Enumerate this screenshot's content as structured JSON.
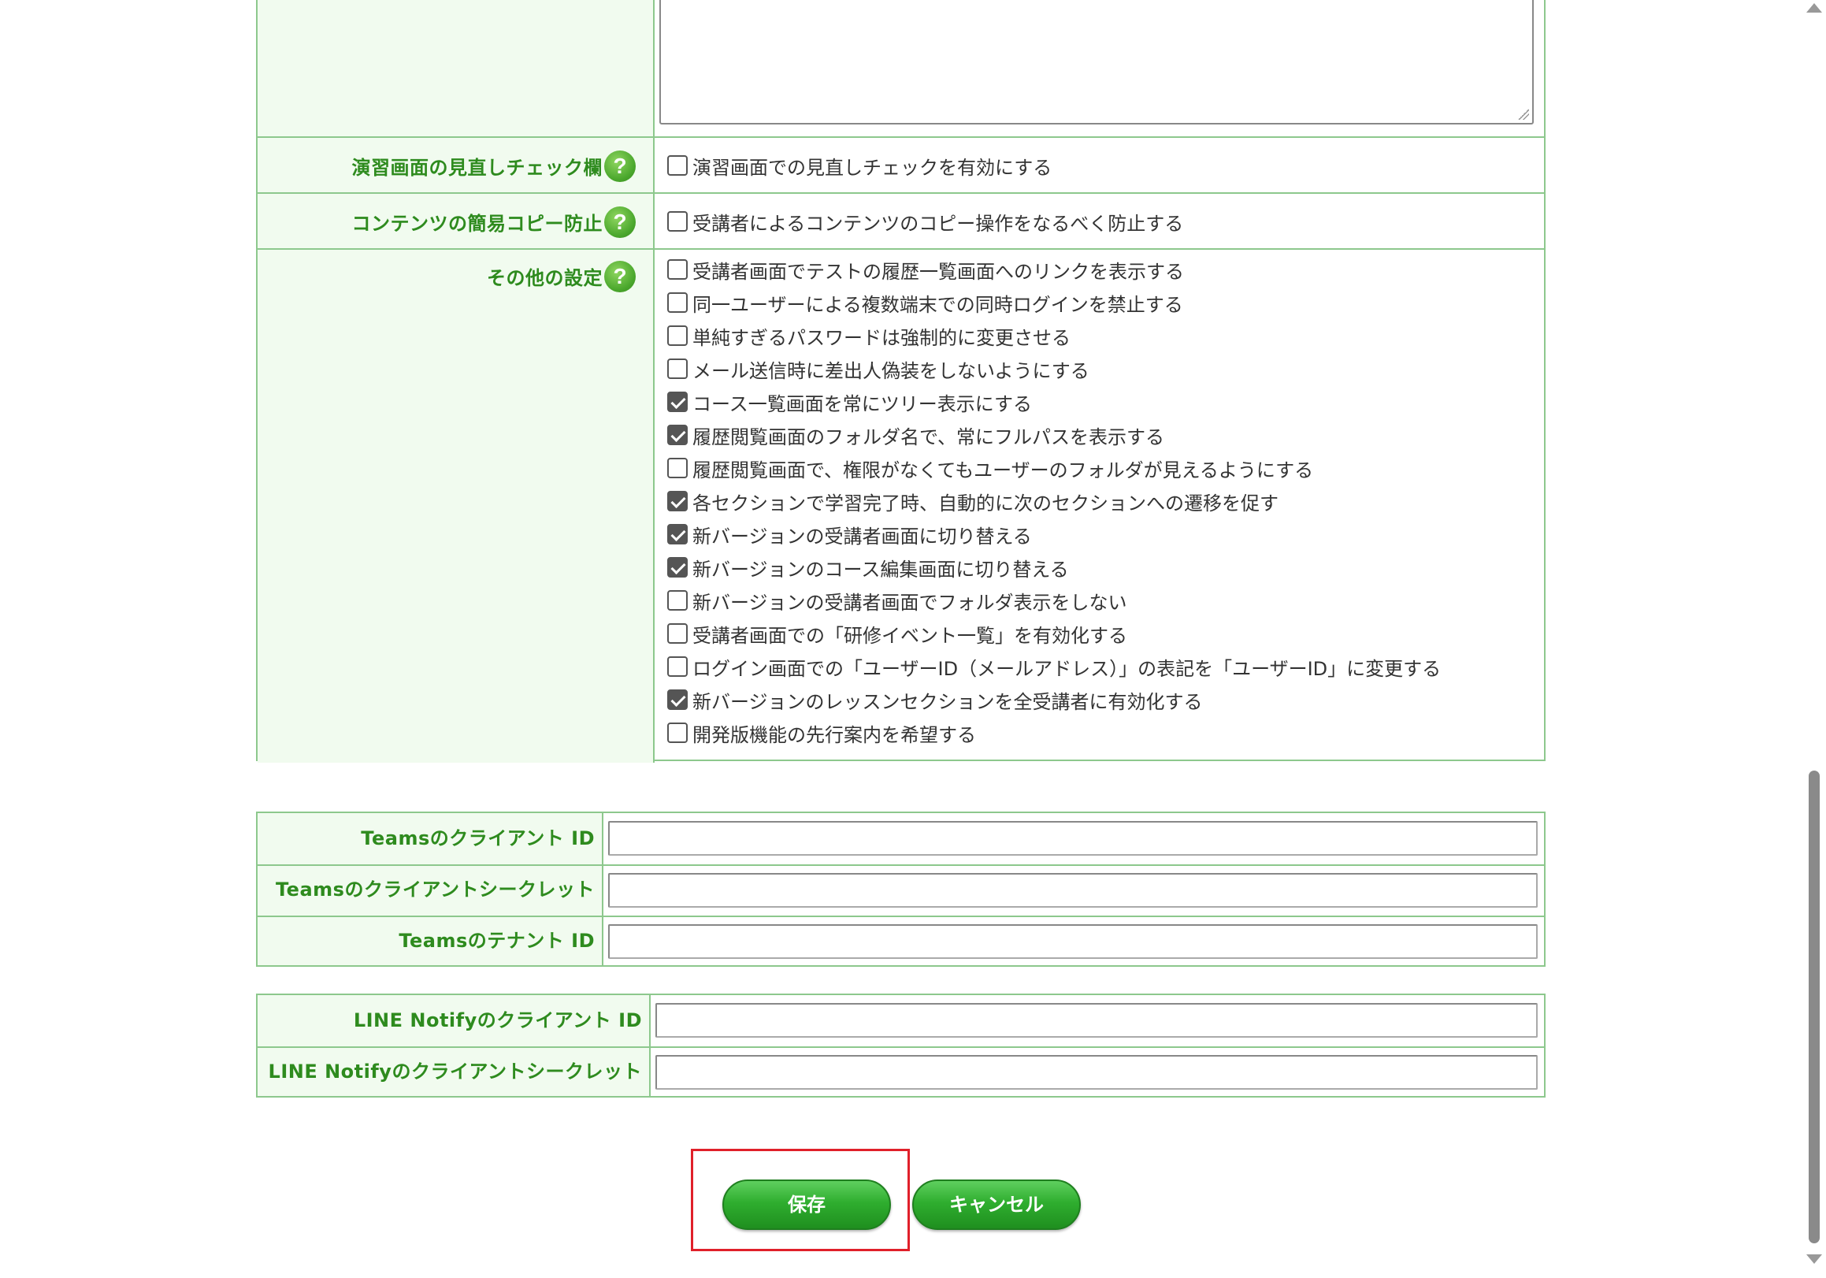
{
  "settings": {
    "exercise_review": {
      "label": "演習画面の見直しチェック欄",
      "option": "演習画面での見直しチェックを有効にする",
      "checked": false
    },
    "copy_protect": {
      "label": "コンテンツの簡易コピー防止",
      "option": "受講者によるコンテンツのコピー操作をなるべく防止する",
      "checked": false
    },
    "other": {
      "label": "その他の設定",
      "options": [
        {
          "label": "受講者画面でテストの履歴一覧画面へのリンクを表示する",
          "checked": false
        },
        {
          "label": "同一ユーザーによる複数端末での同時ログインを禁止する",
          "checked": false
        },
        {
          "label": "単純すぎるパスワードは強制的に変更させる",
          "checked": false
        },
        {
          "label": "メール送信時に差出人偽装をしないようにする",
          "checked": false
        },
        {
          "label": "コース一覧画面を常にツリー表示にする",
          "checked": true
        },
        {
          "label": "履歴閲覧画面のフォルダ名で、常にフルパスを表示する",
          "checked": true
        },
        {
          "label": "履歴閲覧画面で、権限がなくてもユーザーのフォルダが見えるようにする",
          "checked": false
        },
        {
          "label": "各セクションで学習完了時、自動的に次のセクションへの遷移を促す",
          "checked": true
        },
        {
          "label": "新バージョンの受講者画面に切り替える",
          "checked": true
        },
        {
          "label": "新バージョンのコース編集画面に切り替える",
          "checked": true
        },
        {
          "label": "新バージョンの受講者画面でフォルダ表示をしない",
          "checked": false
        },
        {
          "label": "受講者画面での「研修イベント一覧」を有効化する",
          "checked": false
        },
        {
          "label": "ログイン画面での「ユーザーID（メールアドレス）」の表記を「ユーザーID」に変更する",
          "checked": false
        },
        {
          "label": "新バージョンのレッスンセクションを全受講者に有効化する",
          "checked": true
        },
        {
          "label": "開発版機能の先行案内を希望する",
          "checked": false
        }
      ]
    },
    "help_glyph": "?"
  },
  "teams": {
    "client_id_label": "Teamsのクライアント ID",
    "client_secret_label": "Teamsのクライアントシークレット",
    "tenant_id_label": "Teamsのテナント ID"
  },
  "line": {
    "client_id_label": "LINE Notifyのクライアント ID",
    "client_secret_label": "LINE Notifyのクライアントシークレット"
  },
  "actions": {
    "save_label": "保存",
    "cancel_label": "キャンセル"
  },
  "colors": {
    "label_text": "#2e8b1e",
    "border": "#8dc88d",
    "label_bg": "#f1fbef",
    "button": "#2fae2f",
    "highlight": "#e0202a"
  }
}
